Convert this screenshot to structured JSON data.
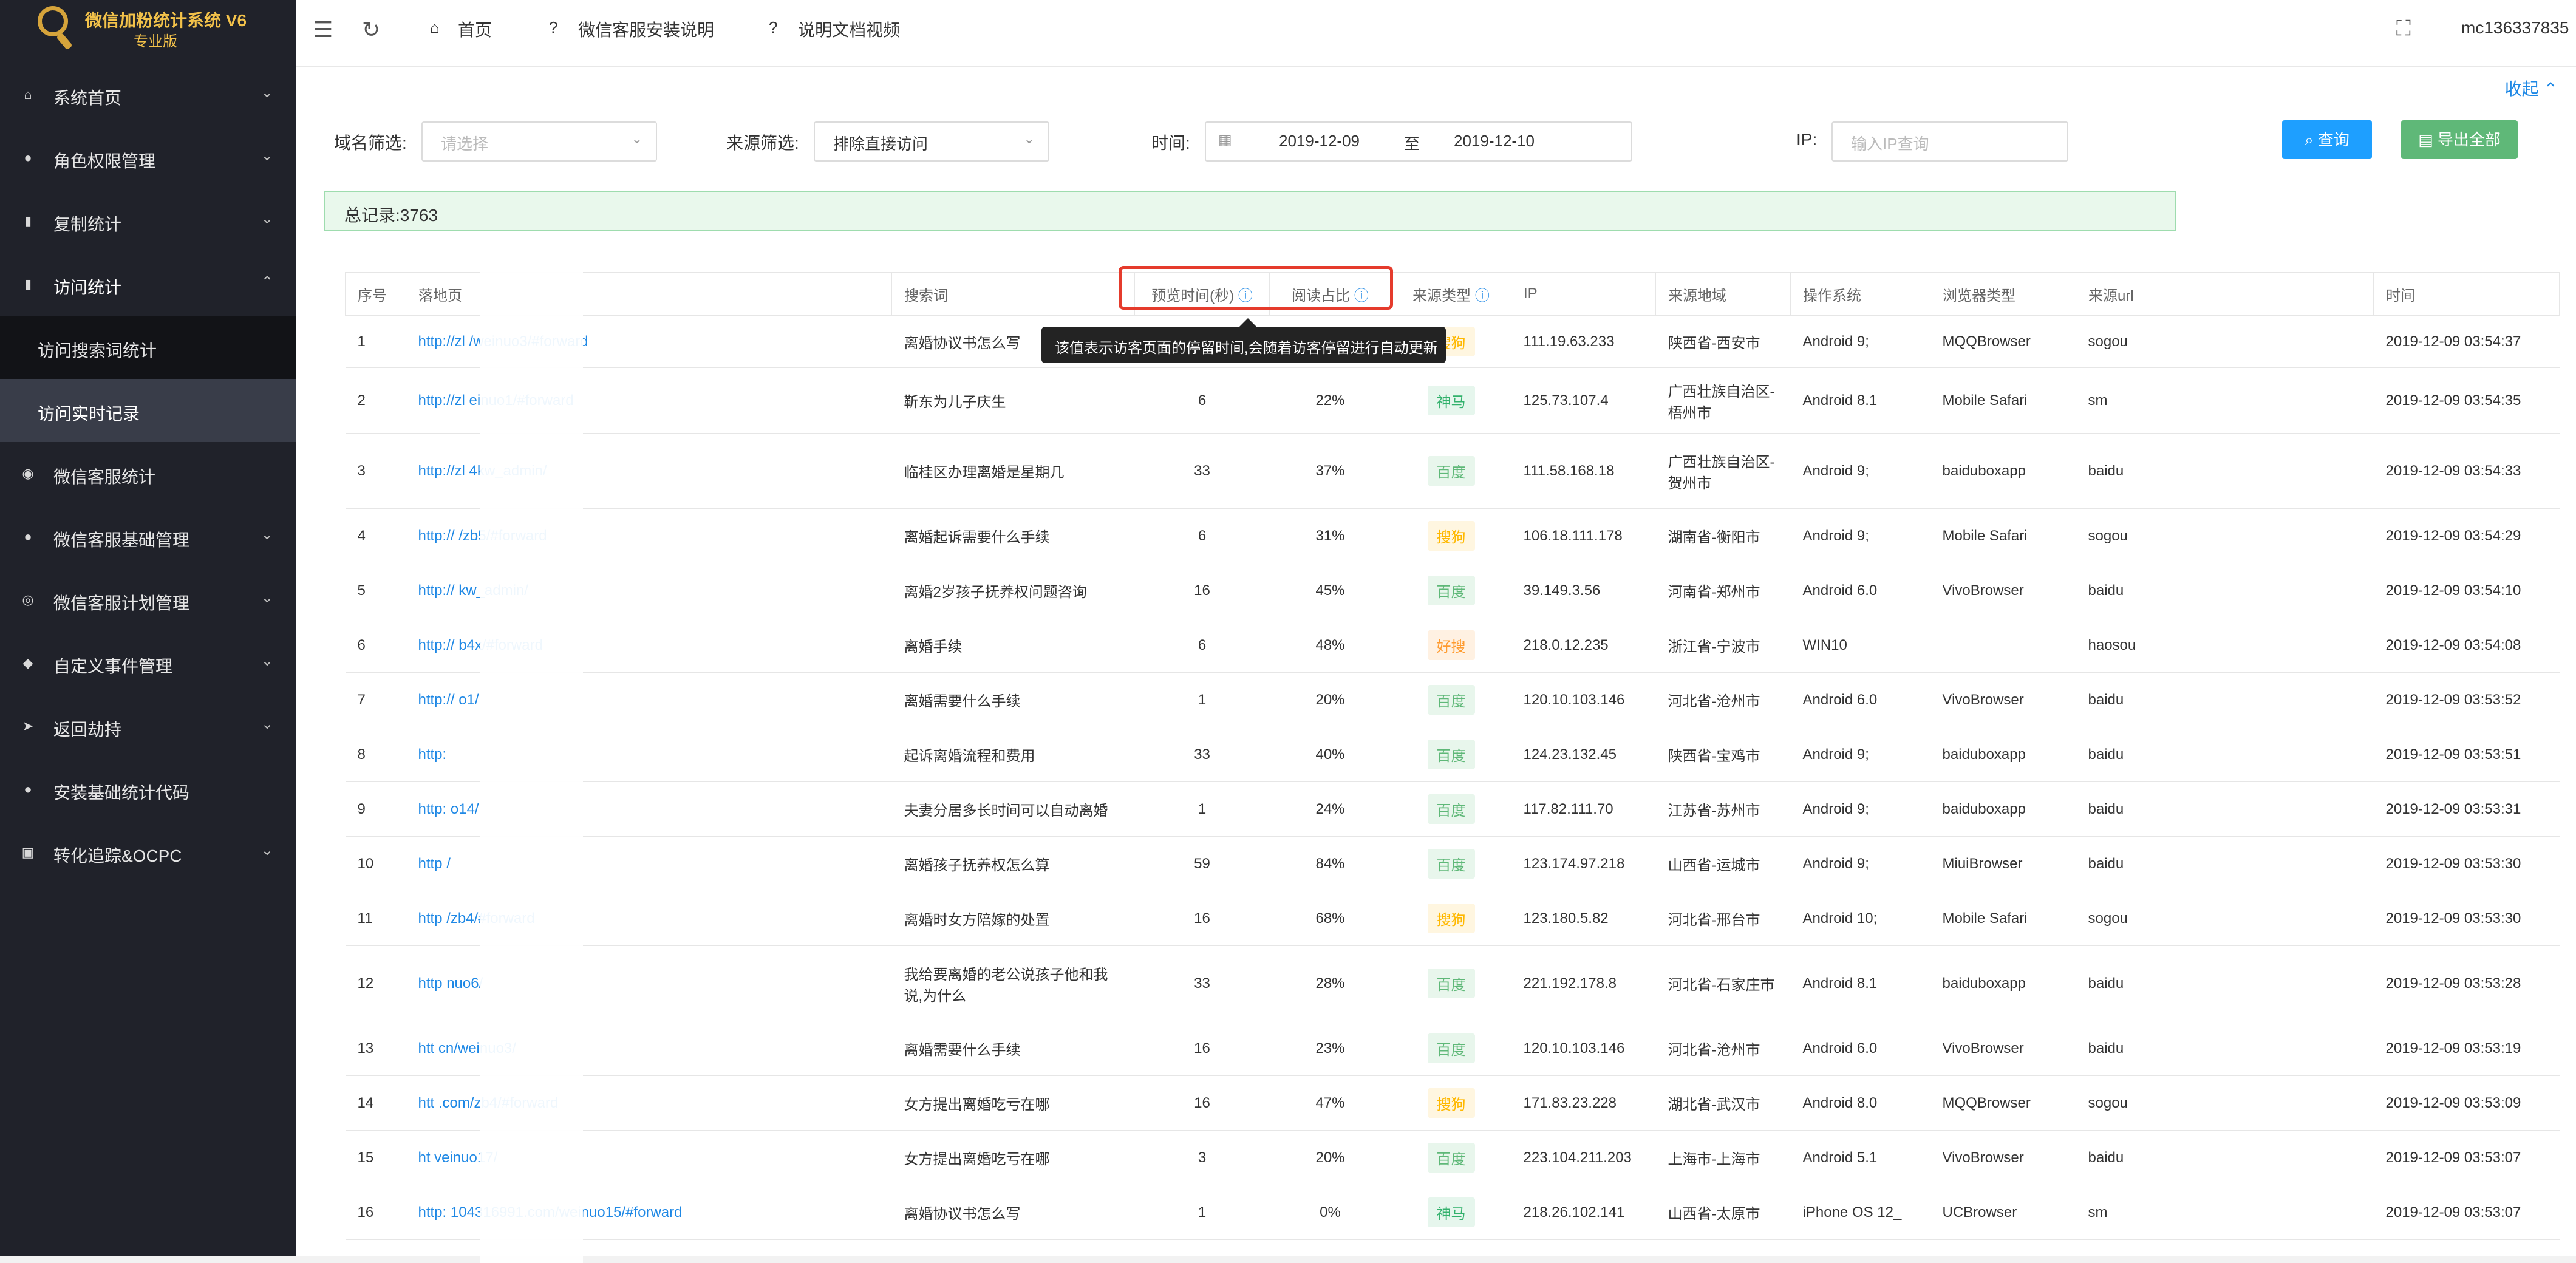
{
  "app": {
    "title": "微信加粉统计系统 V6",
    "edition": "专业版"
  },
  "sidebar": {
    "items": [
      {
        "label": "系统首页",
        "icon": "home-icon"
      },
      {
        "label": "角色权限管理",
        "icon": "user-icon"
      },
      {
        "label": "复制统计",
        "icon": "bar-chart-icon"
      },
      {
        "label": "访问统计",
        "icon": "bar-chart-icon"
      },
      {
        "label": "微信客服统计",
        "icon": "wechat-icon"
      },
      {
        "label": "微信客服基础管理",
        "icon": "users-icon"
      },
      {
        "label": "微信客服计划管理",
        "icon": "gamepad-icon"
      },
      {
        "label": "自定义事件管理",
        "icon": "cube-icon"
      },
      {
        "label": "返回劫持",
        "icon": "send-icon"
      },
      {
        "label": "安装基础统计代码",
        "icon": "dot-icon"
      },
      {
        "label": "转化追踪&OCPC",
        "icon": "briefcase-icon"
      }
    ],
    "subitems": [
      {
        "label": "访问搜索词统计"
      },
      {
        "label": "访问实时记录"
      }
    ]
  },
  "topbar": {
    "tabs": [
      {
        "label": "首页"
      },
      {
        "label": "微信客服安装说明"
      },
      {
        "label": "说明文档视频"
      }
    ],
    "user": "mc136337835"
  },
  "filter": {
    "collapse": "收起",
    "domain_label": "域名筛选:",
    "domain_placeholder": "请选择",
    "source_label": "来源筛选:",
    "source_value": "排除直接访问",
    "time_label": "时间:",
    "date_start": "2019-12-09",
    "date_sep": "至",
    "date_end": "2019-12-10",
    "ip_label": "IP:",
    "ip_placeholder": "输入IP查询",
    "query_button": "查询",
    "export_button": "导出全部",
    "total": "总记录:3763"
  },
  "tooltip": "该值表示访客页面的停留时间,会随着访客停留进行自动更新",
  "table": {
    "headers": [
      "序号",
      "落地页",
      "搜索词",
      "预览时间(秒)",
      "阅读占比",
      "来源类型",
      "IP",
      "来源地域",
      "操作系统",
      "浏览器类型",
      "来源url",
      "时间"
    ],
    "rows": [
      [
        "1",
        "http://zl /weinuo3/#forward",
        "离婚协议书怎么写",
        "",
        "",
        "搜狗",
        "111.19.63.233",
        "陕西省-西安市",
        "Android 9;",
        "MQQBrowser",
        "sogou",
        "2019-12-09 03:54:37"
      ],
      [
        "2",
        "http://zl einuo1/#forward",
        "靳东为儿子庆生",
        "6",
        "22%",
        "神马",
        "125.73.107.4",
        "广西壮族自治区-梧州市",
        "Android 8.1",
        "Mobile Safari",
        "sm",
        "2019-12-09 03:54:35"
      ],
      [
        "3",
        "http://zl 4kw_admin/",
        "临桂区办理离婚是星期几",
        "33",
        "37%",
        "百度",
        "111.58.168.18",
        "广西壮族自治区-贺州市",
        "Android 9;",
        "baiduboxapp",
        "baidu",
        "2019-12-09 03:54:33"
      ],
      [
        "4",
        "http:// /zb5/#forward",
        "离婚起诉需要什么手续",
        "6",
        "31%",
        "搜狗",
        "106.18.111.178",
        "湖南省-衡阳市",
        "Android 9;",
        "Mobile Safari",
        "sogou",
        "2019-12-09 03:54:29"
      ],
      [
        "5",
        "http:// kw_admin/",
        "离婚2岁孩子抚养权问题咨询",
        "16",
        "45%",
        "百度",
        "39.149.3.56",
        "河南省-郑州市",
        "Android 6.0",
        "VivoBrowser",
        "baidu",
        "2019-12-09 03:54:10"
      ],
      [
        "6",
        "http:// b4x/#forward",
        "离婚手续",
        "6",
        "48%",
        "好搜",
        "218.0.12.235",
        "浙江省-宁波市",
        "WIN10",
        "",
        "haosou",
        "2019-12-09 03:54:08"
      ],
      [
        "7",
        "http:// o1/",
        "离婚需要什么手续",
        "1",
        "20%",
        "百度",
        "120.10.103.146",
        "河北省-沧州市",
        "Android 6.0",
        "VivoBrowser",
        "baidu",
        "2019-12-09 03:53:52"
      ],
      [
        "8",
        "http:",
        "起诉离婚流程和费用",
        "33",
        "40%",
        "百度",
        "124.23.132.45",
        "陕西省-宝鸡市",
        "Android 9;",
        "baiduboxapp",
        "baidu",
        "2019-12-09 03:53:51"
      ],
      [
        "9",
        "http: o14/",
        "夫妻分居多长时间可以自动离婚",
        "1",
        "24%",
        "百度",
        "117.82.111.70",
        "江苏省-苏州市",
        "Android 9;",
        "baiduboxapp",
        "baidu",
        "2019-12-09 03:53:31"
      ],
      [
        "10",
        "http /",
        "离婚孩子抚养权怎么算",
        "59",
        "84%",
        "百度",
        "123.174.97.218",
        "山西省-运城市",
        "Android 9;",
        "MiuiBrowser",
        "baidu",
        "2019-12-09 03:53:30"
      ],
      [
        "11",
        "http /zb4/#forward",
        "离婚时女方陪嫁的处置",
        "16",
        "68%",
        "搜狗",
        "123.180.5.82",
        "河北省-邢台市",
        "Android 10;",
        "Mobile Safari",
        "sogou",
        "2019-12-09 03:53:30"
      ],
      [
        "12",
        "http nuo6/",
        "我给要离婚的老公说孩子他和我说,为什么",
        "33",
        "28%",
        "百度",
        "221.192.178.8",
        "河北省-石家庄市",
        "Android 8.1",
        "baiduboxapp",
        "baidu",
        "2019-12-09 03:53:28"
      ],
      [
        "13",
        "htt cn/weinuo3/",
        "离婚需要什么手续",
        "16",
        "23%",
        "百度",
        "120.10.103.146",
        "河北省-沧州市",
        "Android 6.0",
        "VivoBrowser",
        "baidu",
        "2019-12-09 03:53:19"
      ],
      [
        "14",
        "htt .com/zb4/#forward",
        "女方提出离婚吃亏在哪",
        "16",
        "47%",
        "搜狗",
        "171.83.23.228",
        "湖北省-武汉市",
        "Android 8.0",
        "MQQBrowser",
        "sogou",
        "2019-12-09 03:53:09"
      ],
      [
        "15",
        "ht veinuo17/",
        "女方提出离婚吃亏在哪",
        "3",
        "20%",
        "百度",
        "223.104.211.203",
        "上海市-上海市",
        "Android 5.1",
        "VivoBrowser",
        "baidu",
        "2019-12-09 03:53:07"
      ],
      [
        "16",
        "http: 104316991.com/weinuo15/#forward",
        "离婚协议书怎么写",
        "1",
        "0%",
        "神马",
        "218.26.102.141",
        "山西省-太原市",
        "iPhone OS 12_",
        "UCBrowser",
        "sm",
        "2019-12-09 03:53:07"
      ]
    ]
  },
  "colors": {
    "sidebar_bg": "#20222a",
    "primary_blue": "#1e9fff",
    "green": "#5fb878",
    "baidu_green": "#5fb878",
    "sogou_orange": "#ffb800",
    "shenma_green": "#32b16c",
    "haosou_orange": "#ff9b2f",
    "alert_red": "#e53b2c"
  }
}
